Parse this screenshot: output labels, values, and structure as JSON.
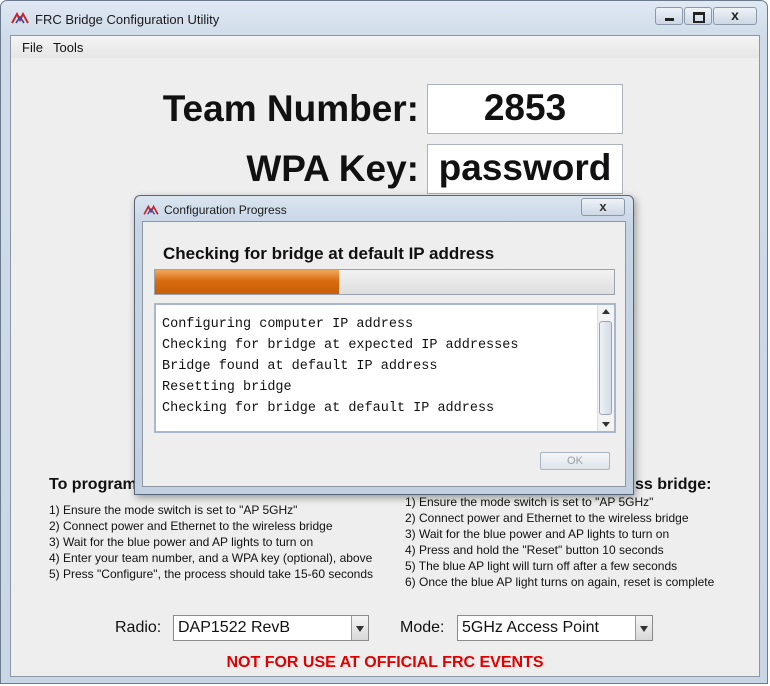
{
  "window": {
    "title": "FRC Bridge Configuration Utility",
    "close_glyph": "x"
  },
  "menu": {
    "items": [
      "File",
      "Tools"
    ]
  },
  "form": {
    "team_label": "Team Number:",
    "team_value": "2853",
    "wpa_label": "WPA Key:",
    "wpa_value": "password"
  },
  "left_instructions": {
    "heading": "To program",
    "steps": [
      "1) Ensure the mode switch is set to \"AP 5GHz\"",
      "2) Connect power and Ethernet to the wireless bridge",
      "3) Wait for the blue power and AP lights to turn on",
      "4) Enter your team number, and a WPA key (optional), above",
      "5) Press \"Configure\", the process should take 15-60 seconds"
    ]
  },
  "right_instructions": {
    "heading": "ss bridge:",
    "steps": [
      "1) Ensure the mode switch is set to \"AP 5GHz\"",
      "2) Connect power and Ethernet to the wireless bridge",
      "3) Wait for the blue power and AP lights to turn on",
      "4) Press and hold the \"Reset\" button 10 seconds",
      "5) The blue AP light will turn off after a few seconds",
      "6) Once the blue AP light turns on again, reset is complete"
    ]
  },
  "bottom": {
    "radio_label": "Radio:",
    "radio_value": "DAP1522 RevB",
    "mode_label": "Mode:",
    "mode_value": "5GHz Access Point",
    "warning": "NOT FOR USE AT OFFICIAL FRC EVENTS"
  },
  "dialog": {
    "title": "Configuration Progress",
    "close_glyph": "x",
    "status": "Checking for bridge at default IP address",
    "progress_fraction": 0.4,
    "log": [
      "Configuring computer IP address",
      "Checking for bridge at expected IP addresses",
      "Bridge found at default IP address",
      "Resetting bridge",
      "Checking for bridge at default IP address"
    ],
    "ok_label": "OK"
  },
  "colors": {
    "warning": "#e00000",
    "progress_fill": "#d86c10",
    "app_icon": "#c0282d"
  },
  "icons": {
    "app": "frc-logo-icon"
  }
}
